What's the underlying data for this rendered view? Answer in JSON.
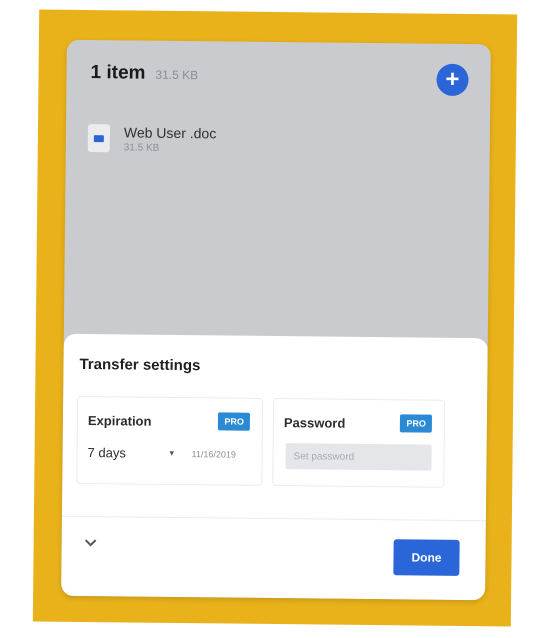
{
  "files": {
    "count_label": "1 item",
    "total_size": "31.5 KB",
    "add_button": "+",
    "items": [
      {
        "name": "Web User .doc",
        "size": "31.5 KB"
      }
    ]
  },
  "transfer_settings": {
    "title": "Transfer settings",
    "expiration": {
      "label": "Expiration",
      "badge": "PRO",
      "value": "7 days",
      "date": "11/16/2019"
    },
    "password": {
      "label": "Password",
      "badge": "PRO",
      "placeholder": "Set password"
    }
  },
  "footer": {
    "done_label": "Done"
  },
  "colors": {
    "frame": "#e9b21a",
    "accent": "#2b66d8",
    "pro_badge": "#2b8ad4"
  }
}
